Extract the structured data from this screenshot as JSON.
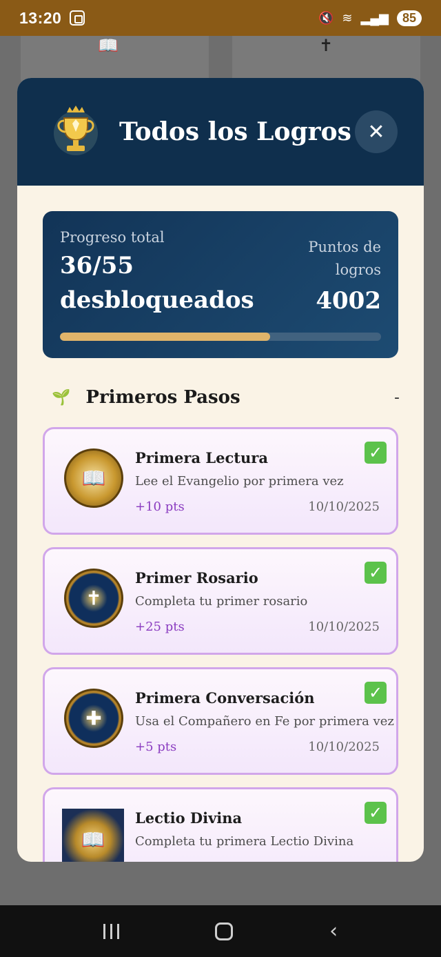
{
  "status_bar": {
    "time": "13:20",
    "battery": "85",
    "icons": [
      "screenshot-icon",
      "mute-icon",
      "wifi-icon",
      "signal-icon"
    ]
  },
  "modal": {
    "title": "Todos los Logros",
    "close_label": "✕",
    "header_icon": "trophy-icon"
  },
  "progress": {
    "label": "Progreso total",
    "value_line1": "36/55",
    "value_line2": "desbloqueados",
    "points_label": "Puntos de logros",
    "points_value": "4002",
    "fraction": 0.655,
    "bar_color": "#e0b46a"
  },
  "section": {
    "icon": "sprout-icon",
    "title": "Primeros Pasos",
    "toggle": "-"
  },
  "achievements": [
    {
      "title": "Primera Lectura",
      "description": "Lee el Evangelio por primera vez",
      "points": "+10 pts",
      "date": "10/10/2025",
      "icon": "bible-medal-icon"
    },
    {
      "title": "Primer Rosario",
      "description": "Completa tu primer rosario",
      "points": "+25 pts",
      "date": "10/10/2025",
      "icon": "cross-medal-icon"
    },
    {
      "title": "Primera Conversación",
      "description": "Usa el Compañero en Fe por primera vez",
      "points": "+5 pts",
      "date": "10/10/2025",
      "icon": "chat-medal-icon"
    },
    {
      "title": "Lectio Divina",
      "description": "Completa tu primera Lectio Divina",
      "points": "",
      "date": "",
      "icon": "lectio-medal-icon"
    }
  ],
  "colors": {
    "header": "#0f2f4d",
    "status_bar": "#8a5a16",
    "card_border": "#d1a6ea",
    "points": "#8a3cc0"
  }
}
